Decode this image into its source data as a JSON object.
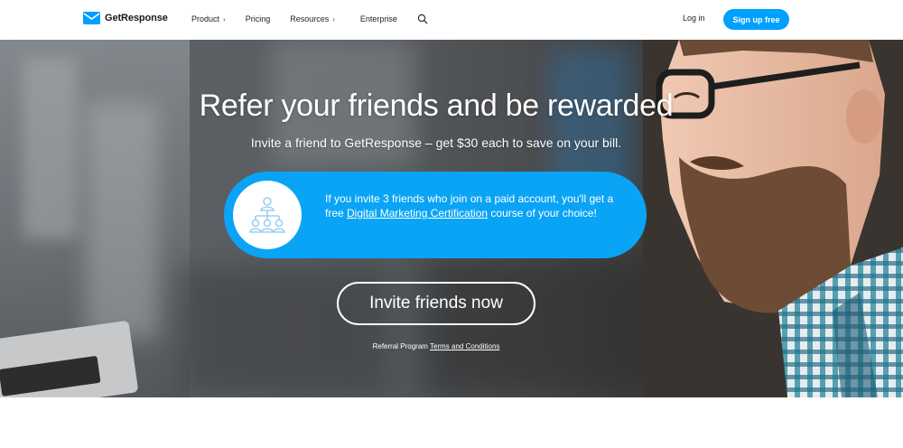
{
  "nav": {
    "logo_text": "GetResponse",
    "links": [
      {
        "label": "Product",
        "chevron": "›"
      },
      {
        "label": "Pricing"
      },
      {
        "label": "Resources",
        "chevron": "›"
      },
      {
        "label": "Enterprise"
      }
    ],
    "search_icon": "search-icon",
    "login_label": "Log in",
    "signup_label": "Sign up free"
  },
  "hero": {
    "title": "Refer your friends and be rewarded",
    "subtitle": "Invite a friend to GetResponse – get $30 each to save on your bill.",
    "pill": {
      "icon": "referral-tree-icon",
      "text_before": "If you invite 3 friends who join on a paid account, you'll get a free ",
      "link_text": "Digital Marketing Certification",
      "text_after": " course of your choice!"
    },
    "cta_label": "Invite friends now",
    "terms_prefix": "Referral Program ",
    "terms_link": "Terms and Conditions"
  },
  "colors": {
    "accent": "#00a0ff",
    "pill": "#0aa4f6",
    "text_dark": "#222222",
    "white": "#ffffff"
  }
}
